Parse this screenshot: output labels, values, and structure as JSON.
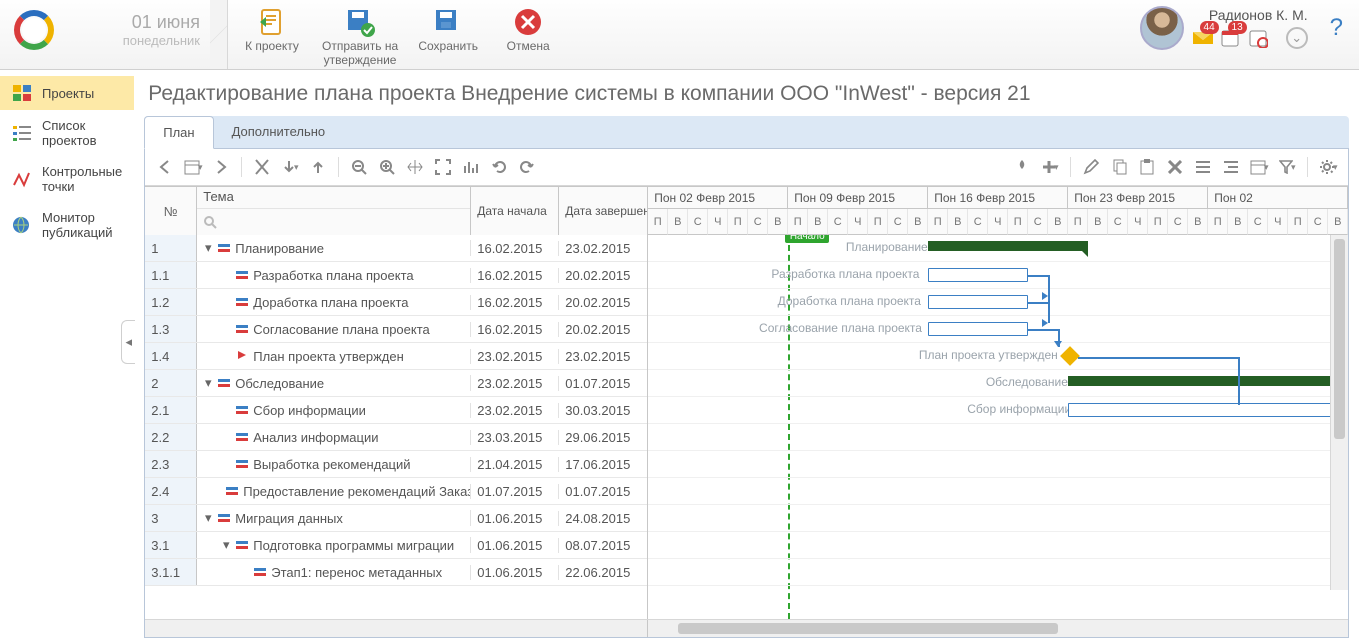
{
  "header": {
    "date": "01 июня",
    "weekday": "понедельник",
    "ribbon": {
      "to_project": "К проекту",
      "submit": "Отправить на\nутверждение",
      "save": "Сохранить",
      "cancel": "Отмена"
    },
    "user": "Радионов К. М.",
    "badge_mail": "44",
    "badge_cal": "13"
  },
  "sidebar": {
    "items": [
      "Проекты",
      "Список проектов",
      "Контрольные точки",
      "Монитор публикаций"
    ]
  },
  "page_title": "Редактирование плана проекта Внедрение системы в компании ООО \"InWest\" - версия 21",
  "tabs": {
    "plan": "План",
    "more": "Дополнительно"
  },
  "grid": {
    "col_num": "№",
    "col_topic": "Тема",
    "col_start": "Дата начала",
    "col_end": "Дата завершения",
    "rows": [
      {
        "n": "1",
        "indent": 0,
        "exp": "▾",
        "name": "Планирование",
        "start": "16.02.2015",
        "end": "23.02.2015"
      },
      {
        "n": "1.1",
        "indent": 1,
        "name": "Разработка плана проекта",
        "start": "16.02.2015",
        "end": "20.02.2015"
      },
      {
        "n": "1.2",
        "indent": 1,
        "name": "Доработка плана проекта",
        "start": "16.02.2015",
        "end": "20.02.2015"
      },
      {
        "n": "1.3",
        "indent": 1,
        "name": "Согласование плана проекта",
        "start": "16.02.2015",
        "end": "20.02.2015"
      },
      {
        "n": "1.4",
        "indent": 1,
        "ms": true,
        "name": "План проекта утвержден",
        "start": "23.02.2015",
        "end": "23.02.2015"
      },
      {
        "n": "2",
        "indent": 0,
        "exp": "▾",
        "name": "Обследование",
        "start": "23.02.2015",
        "end": "01.07.2015"
      },
      {
        "n": "2.1",
        "indent": 1,
        "name": "Сбор информации",
        "start": "23.02.2015",
        "end": "30.03.2015"
      },
      {
        "n": "2.2",
        "indent": 1,
        "name": "Анализ информации",
        "start": "23.03.2015",
        "end": "29.06.2015"
      },
      {
        "n": "2.3",
        "indent": 1,
        "name": "Выработка рекомендаций",
        "start": "21.04.2015",
        "end": "17.06.2015"
      },
      {
        "n": "2.4",
        "indent": 1,
        "name": "Предоставление рекомендаций Заказч...",
        "start": "01.07.2015",
        "end": "01.07.2015"
      },
      {
        "n": "3",
        "indent": 0,
        "exp": "▾",
        "name": "Миграция данных",
        "start": "01.06.2015",
        "end": "24.08.2015"
      },
      {
        "n": "3.1",
        "indent": 1,
        "exp": "▾",
        "name": "Подготовка программы миграции",
        "start": "01.06.2015",
        "end": "08.07.2015"
      },
      {
        "n": "3.1.1",
        "indent": 2,
        "name": "Этап1: перенос метаданных",
        "start": "01.06.2015",
        "end": "22.06.2015"
      }
    ]
  },
  "timeline": {
    "weeks": [
      "Пон 02 Февр 2015",
      "Пон 09 Февр 2015",
      "Пон 16 Февр 2015",
      "Пон 23 Февр 2015",
      "Пон 02"
    ],
    "days": [
      "П",
      "В",
      "С",
      "Ч",
      "П",
      "С",
      "В"
    ],
    "start_label": "Начало",
    "row_labels": [
      "Планирование",
      "Разработка плана проекта",
      "Доработка плана проекта",
      "Согласование плана проекта",
      "План проекта утвержден",
      "Обследование",
      "Сбор информации"
    ]
  }
}
